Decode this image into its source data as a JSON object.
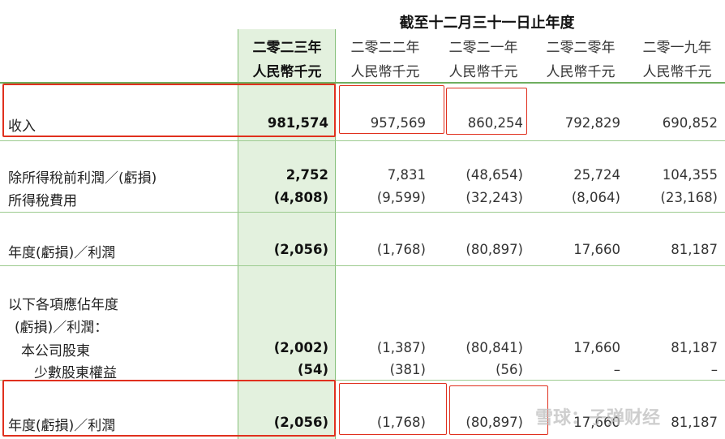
{
  "header": {
    "period_caption": "截至十二月三十一日止年度",
    "years": [
      "二零二三年",
      "二零二二年",
      "二零二一年",
      "二零二零年",
      "二零一九年"
    ],
    "unit": "人民幣千元"
  },
  "rows": {
    "revenue": {
      "label": "收入",
      "values": [
        "981,574",
        "957,569",
        "860,254",
        "792,829",
        "690,852"
      ]
    },
    "pretax": {
      "label": "除所得稅前利潤／(虧損)",
      "values": [
        "2,752",
        "7,831",
        "(48,654)",
        "25,724",
        "104,355"
      ]
    },
    "tax": {
      "label": "所得稅費用",
      "values": [
        "(4,808)",
        "(9,599)",
        "(32,243)",
        "(8,064)",
        "(23,168)"
      ]
    },
    "year_result": {
      "label": "年度(虧損)／利潤",
      "values": [
        "(2,056)",
        "(1,768)",
        "(80,897)",
        "17,660",
        "81,187"
      ]
    },
    "attrib_title_1": "以下各項應佔年度",
    "attrib_title_2": "(虧損)／利潤：",
    "owners": {
      "label": "本公司股東",
      "values": [
        "(2,002)",
        "(1,387)",
        "(80,841)",
        "17,660",
        "81,187"
      ]
    },
    "minority": {
      "label": "少數股東權益",
      "values": [
        "(54)",
        "(381)",
        "(56)",
        "–",
        "–"
      ]
    },
    "year_result_total": {
      "label": "年度(虧損)／利潤",
      "values": [
        "(2,056)",
        "(1,768)",
        "(80,897)",
        "17,660",
        "81,187"
      ]
    }
  },
  "watermark": "雪球：子弹财经",
  "colors": {
    "green_column": "#e3f1de",
    "green_line": "#6fae5f",
    "highlight_red": "#e0301e"
  }
}
